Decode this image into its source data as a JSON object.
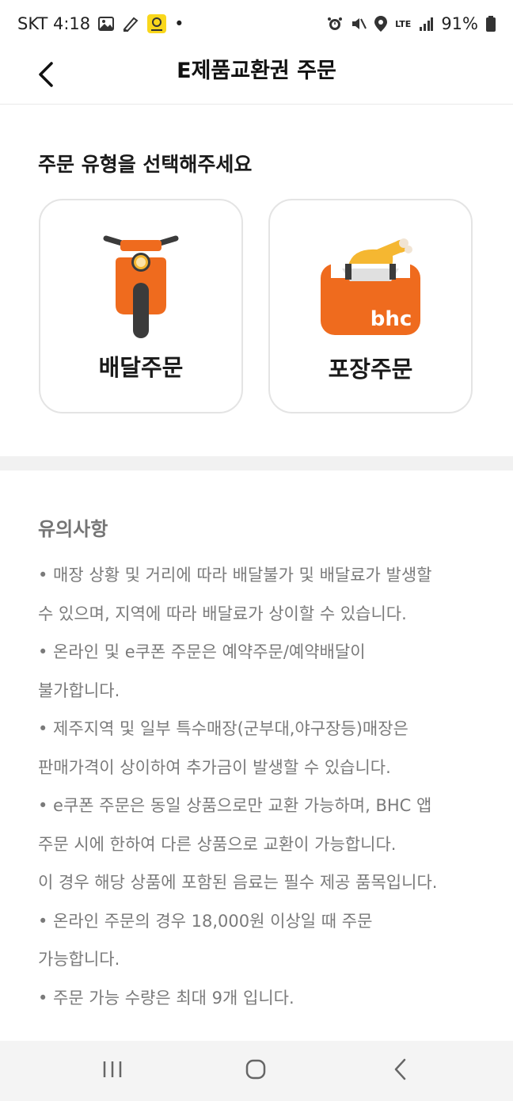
{
  "status_bar": {
    "carrier_time": "SKT 4:18",
    "dot": "•",
    "network": "LTE",
    "battery": "91%",
    "icons": [
      "image-icon",
      "pen-icon",
      "app-notification-icon",
      "alarm-icon",
      "mute-icon",
      "location-icon",
      "signal-icon",
      "battery-icon"
    ]
  },
  "header": {
    "title": "E제품교환권 주문",
    "back_icon": "chevron-left-icon"
  },
  "order_type": {
    "heading": "주문 유형을 선택해주세요",
    "options": [
      {
        "label": "배달주문",
        "icon": "scooter-icon"
      },
      {
        "label": "포장주문",
        "icon": "chicken-box-icon",
        "icon_text": "bhc"
      }
    ]
  },
  "notice": {
    "title": "유의사항",
    "lines": [
      "• 매장 상황 및 거리에 따라 배달불가 및 배달료가 발생할",
      "수 있으며, 지역에 따라 배달료가 상이할 수 있습니다.",
      "• 온라인 및 e쿠폰 주문은 예약주문/예약배달이",
      "불가합니다.",
      "• 제주지역 및 일부 특수매장(군부대,야구장등)매장은",
      "판매가격이 상이하여 추가금이 발생할 수 있습니다.",
      "• e쿠폰 주문은 동일 상품으로만 교환 가능하며, BHC 앱",
      "주문 시에 한하여 다른 상품으로 교환이 가능합니다.",
      "이 경우 해당 상품에 포함된 음료는 필수 제공 품목입니다.",
      "• 온라인 주문의 경우 18,000원 이상일 때 주문",
      "가능합니다.",
      "• 주문 가능 수량은 최대 9개 입니다."
    ]
  },
  "colors": {
    "brand_orange": "#EF6B1E",
    "dark_gray": "#3b3b3b",
    "chicken_yellow": "#F5B731",
    "notice_text": "#7a7a7a"
  },
  "nav_bar": {
    "items": [
      "recent-apps-icon",
      "home-icon",
      "back-icon"
    ]
  }
}
